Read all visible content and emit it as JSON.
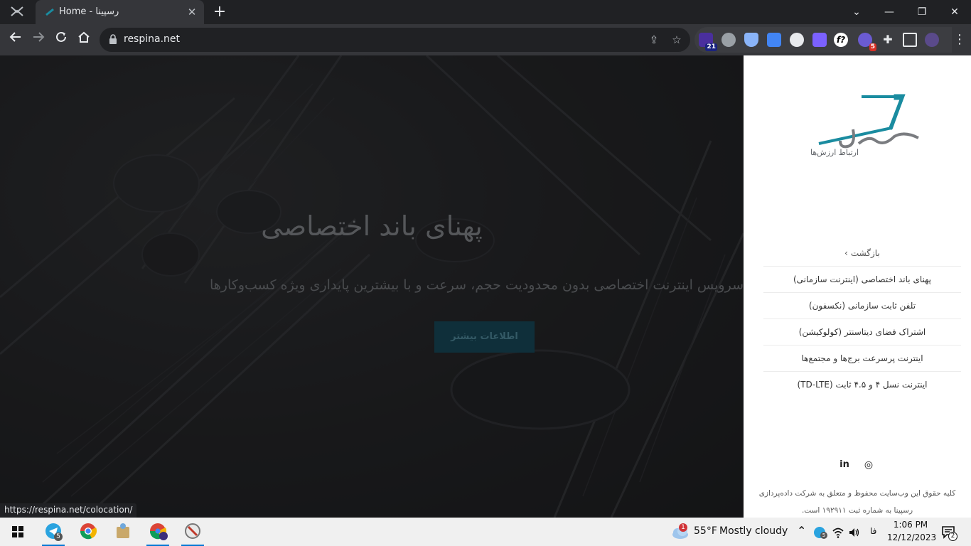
{
  "browser": {
    "tab_title": "Home - رسپینا",
    "tab_close": "✕",
    "new_tab": "+",
    "url": "respina.net",
    "window_controls": [
      "⌄",
      "—",
      "❐",
      "✕"
    ],
    "extensions": [
      {
        "name": "ext-1",
        "badge": "21",
        "color": "#4a2f9e"
      },
      {
        "name": "screenshot",
        "badge": "",
        "color": "#9aa0a6"
      },
      {
        "name": "shield",
        "badge": "",
        "color": "#8ab4f8"
      },
      {
        "name": "translate",
        "badge": "",
        "color": "#4285f4"
      },
      {
        "name": "ext-circle",
        "badge": "",
        "color": "#e8eaed"
      },
      {
        "name": "ext-square",
        "badge": "",
        "color": "#7b61ff"
      },
      {
        "name": "font-ext",
        "badge": "",
        "color": "#ffffff"
      },
      {
        "name": "vpn-ext",
        "badge": "5",
        "color": "#6b5bd2"
      }
    ]
  },
  "hero": {
    "title": "پهنای باند اختصاصی",
    "subtitle": "سرویس اینترنت اختصاصی بدون محدودیت حجم، سرعت و با بیشترین پایداری ویژه کسب‌وکارها",
    "button": "اطلاعات بیشتر"
  },
  "sidebar": {
    "logo_text": "رسپینا",
    "logo_tagline": "ارتباط ارزش‌ها",
    "back": "بازگشت",
    "back_chevron": "‹",
    "items": [
      "پهنای باند اختصاصی (اینترنت سازمانی)",
      "تلفن ثابت سازمانی (نکسفون)",
      "اشتراک فضای دیتاسنتر (کولوکیشن)",
      "اینترنت پرسرعت برج‌ها و مجتمع‌ها",
      "اینترنت نسل ۴ و ۴.۵ ثابت (TD-LTE)"
    ],
    "social": [
      "in",
      "◎"
    ],
    "copyright": "کلیه حقوق این وب‌سایت محفوظ و متعلق به شرکت داده‌پردازی رسپینا به شماره ثبت ۱۹۲۹۱۱ است."
  },
  "status_url": "https://respina.net/colocation/",
  "taskbar": {
    "telegram_badge": "5",
    "weather_alert": "1",
    "temperature": "55°F",
    "weather": "Mostly cloudy",
    "tray_badge": "5",
    "language": "فا",
    "time": "1:06 PM",
    "date": "12/12/2023",
    "notifications": "2"
  }
}
